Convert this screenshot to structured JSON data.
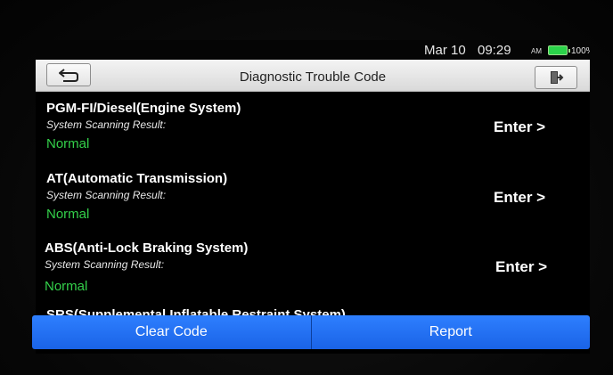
{
  "status": {
    "date": "Mar 10",
    "time": "09:29",
    "ampm": "AM",
    "battery": "100%",
    "battery_level": 1.0,
    "battery_color": "#2bd34a"
  },
  "header": {
    "title": "Diagnostic Trouble Code",
    "back_icon": "back-arrow-icon",
    "exit_icon": "exit-door-icon"
  },
  "systems": [
    {
      "name": "PGM-FI/Diesel(Engine System)",
      "label": "System Scanning Result:",
      "result": "Normal",
      "action": "Enter >"
    },
    {
      "name": "AT(Automatic Transmission)",
      "label": "System Scanning Result:",
      "result": "Normal",
      "action": "Enter >"
    },
    {
      "name": "ABS(Anti-Lock Braking System)",
      "label": "System Scanning Result:",
      "result": "Normal",
      "action": "Enter >"
    }
  ],
  "partial_system": "SRS(Supplemental Inflatable Restraint System)",
  "actions": {
    "clear_code": "Clear Code",
    "report": "Report"
  },
  "colors": {
    "result_normal": "#33d04a",
    "action_bar": "#1f6ff0"
  }
}
